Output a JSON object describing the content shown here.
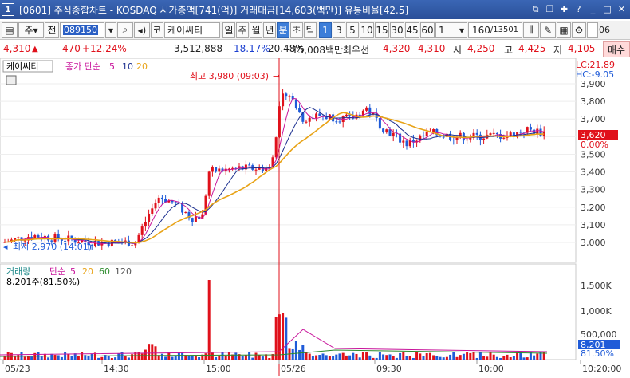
{
  "titlebar": {
    "window_number": "1",
    "title": "[0601] 주식종합차트 - KOSDAQ 시가총액[741(억)] 거래대금[14,603(백만)] 유통비율[42.5]"
  },
  "toolbar": {
    "market": "주",
    "prev_label": "전",
    "code": "089150",
    "code_prefix": "코",
    "stock_name": "케이씨티",
    "periods": [
      "일",
      "주",
      "월",
      "년",
      "분",
      "초",
      "틱"
    ],
    "active_period": "분",
    "intervals": [
      "1",
      "3",
      "5",
      "10",
      "15",
      "30",
      "45",
      "60"
    ],
    "active_interval": "1",
    "interval_value": "1",
    "count": "160",
    "total": "/13501",
    "right_input": "06"
  },
  "quote": {
    "price": "4,310",
    "change": "470",
    "change_pct": "+12.24%",
    "volume": "3,512,888",
    "vol_ratio": "18.17%",
    "turnover": "20.48%",
    "amount": "15,008백만",
    "best_label": "최우선",
    "ask": "4,320",
    "bid": "4,310",
    "open_label": "시",
    "open": "4,250",
    "high_label": "고",
    "high": "4,425",
    "low_label": "저",
    "low": "4,105",
    "buy_button": "매수"
  },
  "price_panel": {
    "name_label": "케이씨티",
    "ma_label": "종가 단순",
    "ma_periods": [
      "5",
      "10",
      "20"
    ],
    "lc": "LC:21.89",
    "hc": "HC:-9.05",
    "high_annotation": "최고 3,980 (09:03)",
    "low_annotation": "최저 2,970 (14:01)",
    "current_price": "3,620",
    "current_pct": "0.00%",
    "y_ticks": [
      "3,900",
      "3,800",
      "3,700",
      "3,600",
      "3,500",
      "3,400",
      "3,300",
      "3,200",
      "3,100",
      "3,000"
    ]
  },
  "volume_panel": {
    "label": "거래량",
    "ma_label": "단순",
    "ma_periods": [
      "5",
      "20",
      "60",
      "120"
    ],
    "current": "8,201주(81.50%)",
    "y_ticks": [
      "1,500K",
      "1,000K",
      "500,000"
    ],
    "current_value": "8,201",
    "current_pct": "81.50%"
  },
  "x_axis": {
    "labels": [
      "05/23",
      "14:30",
      "15:00",
      "05/26",
      "09:30",
      "10:00",
      "10:20:00"
    ]
  },
  "colors": {
    "up": "#e0111b",
    "down": "#1f5bd8",
    "ma5": "#c8149b",
    "ma10": "#1a2e8f",
    "ma20": "#e8a317",
    "vline": "#e0111b"
  }
}
